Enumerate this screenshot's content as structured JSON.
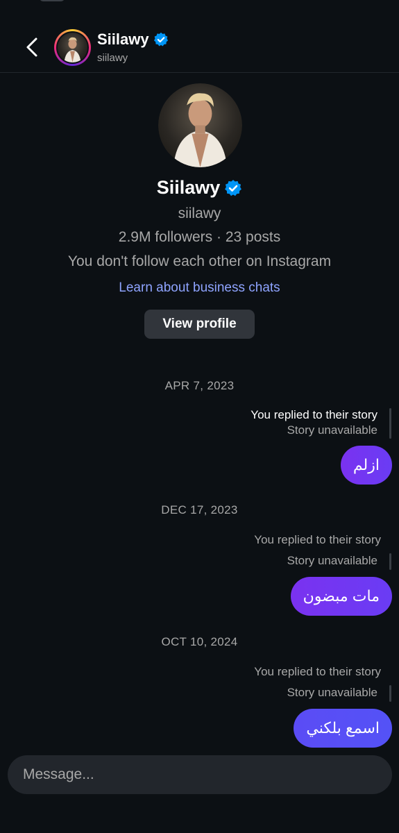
{
  "header": {
    "name": "Siilawy",
    "handle": "siilawy"
  },
  "profile": {
    "name": "Siilawy",
    "handle": "siilawy",
    "stats": "2.9M followers · 23 posts",
    "follow_status": "You don't follow each other on Instagram",
    "learn_link": "Learn about business chats",
    "view_profile_label": "View profile"
  },
  "messages": [
    {
      "date": "APR 7, 2023",
      "reply_title": "You replied to their story",
      "reply_sub": "Story unavailable",
      "text": "ازلم"
    },
    {
      "date": "DEC 17, 2023",
      "reply_title": "You replied to their story",
      "reply_sub": "Story unavailable",
      "text": "مات مبضون"
    },
    {
      "date": "OCT 10, 2024",
      "reply_title": "You replied to their story",
      "reply_sub": "Story unavailable",
      "text": "اسمع بلكني"
    }
  ],
  "composer": {
    "placeholder": "Message..."
  },
  "colors": {
    "background": "#0c1014",
    "bubble": "#7a32f0",
    "link": "#8fa4ff",
    "verified": "#0095f6"
  }
}
